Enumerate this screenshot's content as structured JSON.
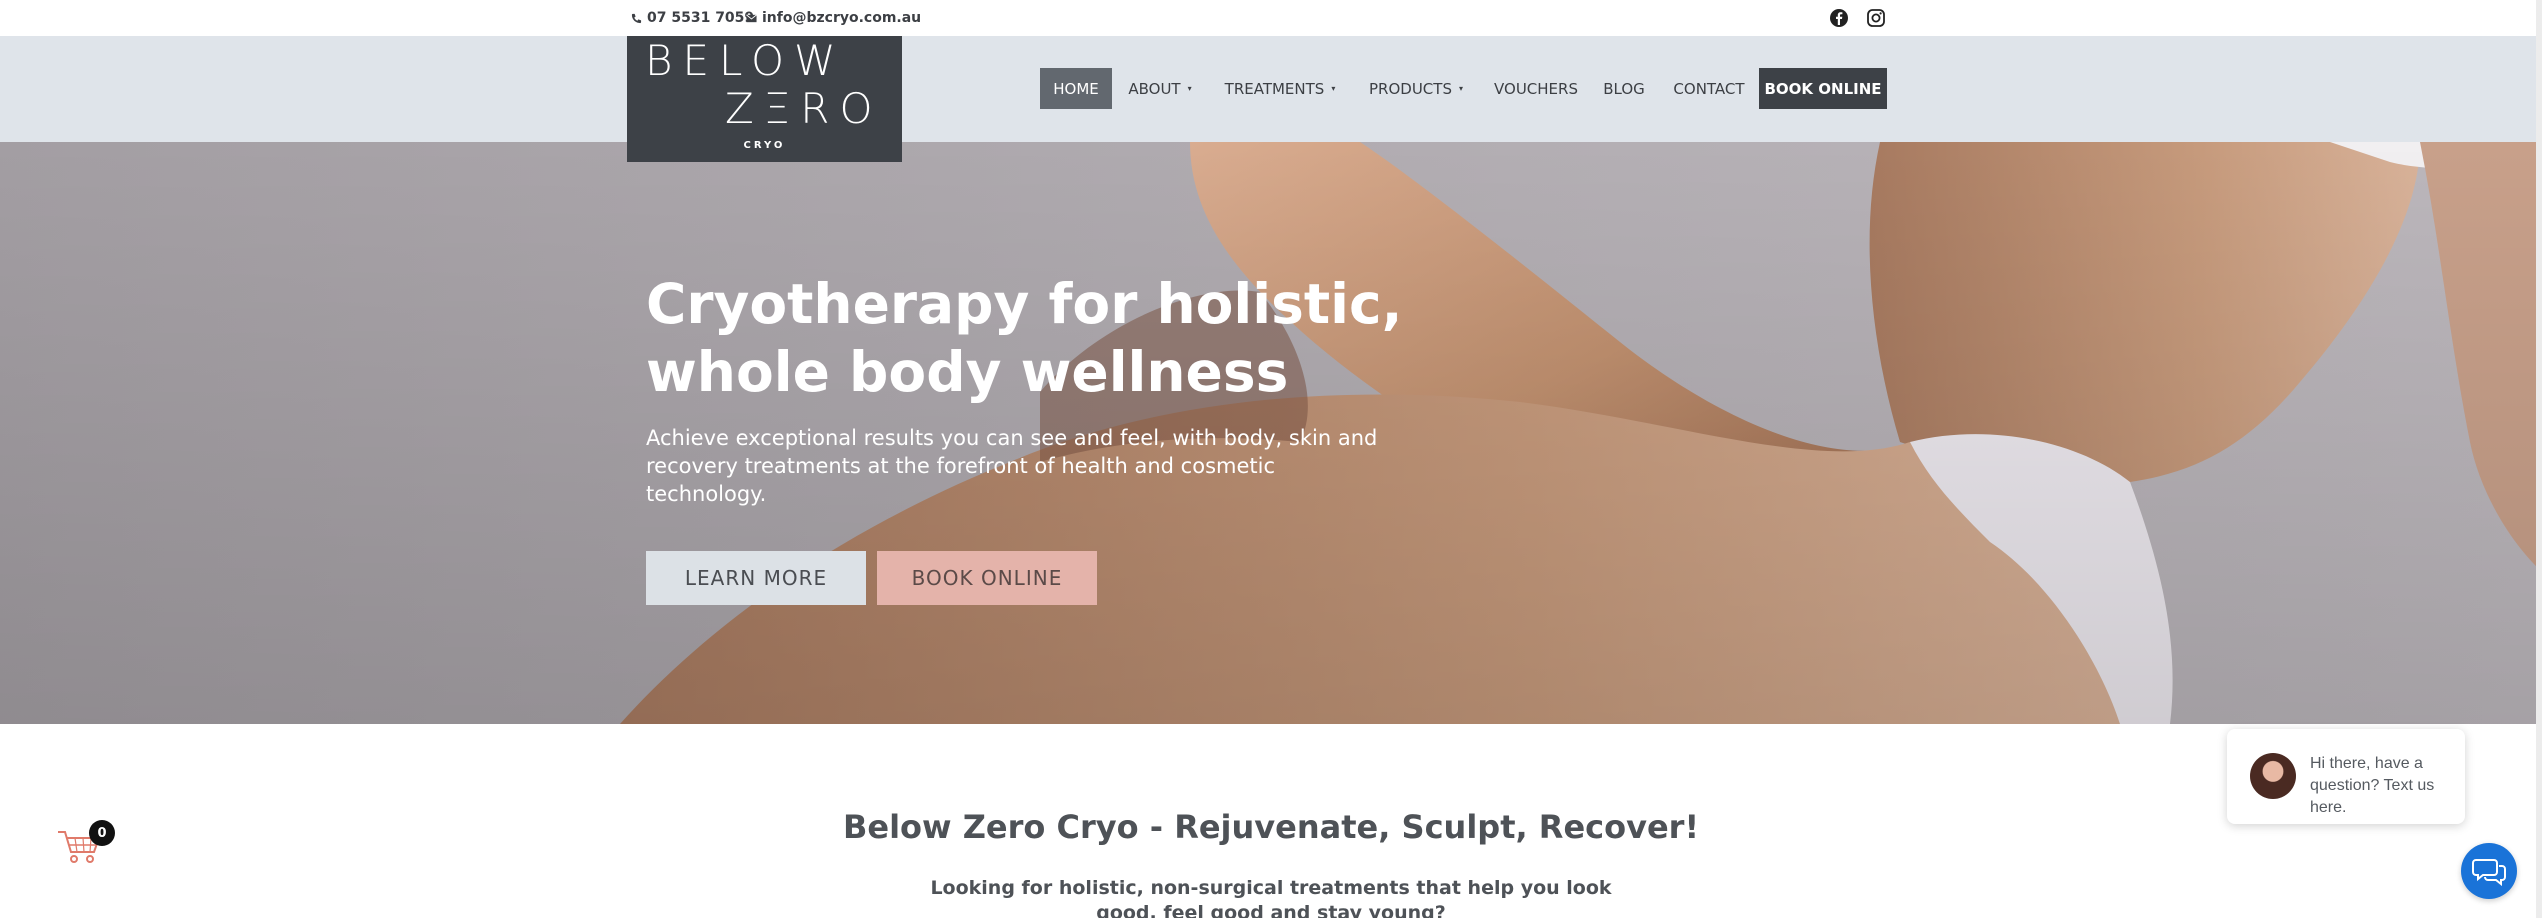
{
  "topbar": {
    "phone": "07 5531 7059",
    "email": "info@bzcryo.com.au",
    "social_icons": [
      "facebook-icon",
      "instagram-icon"
    ]
  },
  "logo": {
    "line1": "BELOW",
    "line2": "ZΞRO",
    "line3": "CRYO"
  },
  "nav": {
    "items": [
      {
        "label": "HOME",
        "active": true
      },
      {
        "label": "ABOUT",
        "dropdown": true
      },
      {
        "label": "TREATMENTS",
        "dropdown": true
      },
      {
        "label": "PRODUCTS",
        "dropdown": true
      },
      {
        "label": "VOUCHERS"
      },
      {
        "label": "BLOG"
      },
      {
        "label": "CONTACT"
      }
    ],
    "caret": "▾",
    "cta": "BOOK ONLINE"
  },
  "hero": {
    "title_line1": "Cryotherapy for holistic,",
    "title_line2": "whole body wellness",
    "subtitle": "Achieve exceptional results you can see and feel, with body, skin and recovery treatments at the forefront of health and cosmetic technology.",
    "learn_more": "LEARN MORE",
    "book_online": "BOOK ONLINE"
  },
  "intro": {
    "title": "Below Zero Cryo - Rejuvenate, Sculpt, Recover!",
    "text": "Looking for holistic, non-surgical treatments that help you look good, feel good and stay young?"
  },
  "cart": {
    "count": "0"
  },
  "chat": {
    "message": "Hi there, have a question? Text us here."
  },
  "colors": {
    "header_bg": "#dfe4ea",
    "logo_bg": "#3d4147",
    "cta_bg": "#3d4147",
    "book_button": "#e4b3aa",
    "chat_button": "#1a73d8"
  }
}
